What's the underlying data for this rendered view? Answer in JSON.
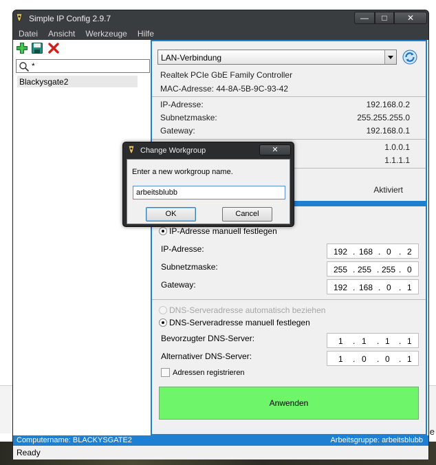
{
  "window": {
    "title": "Simple IP Config 2.9.7",
    "minimize": "—",
    "maximize": "□",
    "close": "✕"
  },
  "menu": [
    "Datei",
    "Ansicht",
    "Werkzeuge",
    "Hilfe"
  ],
  "toolbar": {
    "icons": [
      "add-icon",
      "save-icon",
      "delete-icon"
    ]
  },
  "search": {
    "value": "*"
  },
  "profiles": [
    "Blackysgate2"
  ],
  "adapter": {
    "selected": "LAN-Verbindung",
    "description": "Realtek PCIe GbE Family Controller",
    "mac": "MAC-Adresse: 44-8A-5B-9C-93-42"
  },
  "current": {
    "ip_label": "IP-Adresse:",
    "ip_value": "192.168.0.2",
    "subnet_label": "Subnetzmaske:",
    "subnet_value": "255.255.255.0",
    "gateway_label": "Gateway:",
    "gateway_value": "192.168.0.1",
    "dns1_value": "1.0.0.1",
    "dns2_value": "1.1.1.1",
    "dhcp_value": "Aktiviert"
  },
  "ip_settings": {
    "manual_label": "IP-Adresse manuell festlegen",
    "ip_label": "IP-Adresse:",
    "ip": [
      "192",
      "168",
      "0",
      "2"
    ],
    "subnet_label": "Subnetzmaske:",
    "subnet": [
      "255",
      "255",
      "255",
      "0"
    ],
    "gateway_label": "Gateway:",
    "gateway": [
      "192",
      "168",
      "0",
      "1"
    ]
  },
  "dns_settings": {
    "auto_label": "DNS-Serveradresse automatisch beziehen",
    "manual_label": "DNS-Serveradresse manuell festlegen",
    "preferred_label": "Bevorzugter DNS-Server:",
    "preferred": [
      "1",
      "1",
      "1",
      "1"
    ],
    "alternate_label": "Alternativer DNS-Server:",
    "alternate": [
      "1",
      "0",
      "0",
      "1"
    ],
    "register_label": "Adressen registrieren"
  },
  "apply_label": "Anwenden",
  "status": {
    "computername": "Computername: BLACKYSGATE2",
    "workgroup": "Arbeitsgruppe: arbeitsblubb",
    "ready": "Ready"
  },
  "dialog": {
    "title": "Change Workgroup",
    "prompt": "Enter a new workgroup name.",
    "value": "arbeitsblubb",
    "ok": "OK",
    "cancel": "Cancel"
  },
  "background_text": "e",
  "colors": {
    "accent": "#1f7fd0",
    "apply": "#6ef56a",
    "titlebar": "#3a3d40"
  }
}
